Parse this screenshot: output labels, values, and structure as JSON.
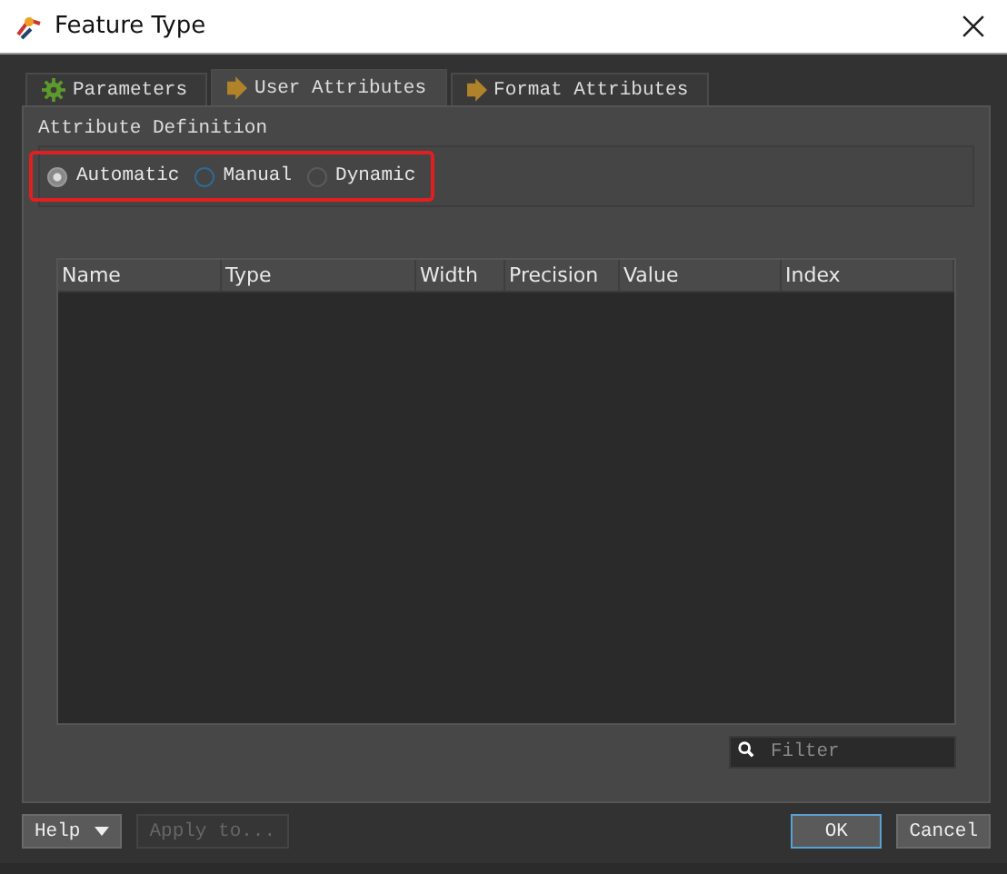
{
  "window": {
    "title": "Feature Type"
  },
  "tabs": [
    {
      "label": "Parameters",
      "selected": false
    },
    {
      "label": "User Attributes",
      "selected": true
    },
    {
      "label": "Format Attributes",
      "selected": false
    }
  ],
  "attribute_definition": {
    "label": "Attribute Definition",
    "options": [
      {
        "label": "Automatic",
        "selected": true,
        "focused": false
      },
      {
        "label": "Manual",
        "selected": false,
        "focused": true
      },
      {
        "label": "Dynamic",
        "selected": false,
        "focused": false
      }
    ]
  },
  "table": {
    "columns": [
      "Name",
      "Type",
      "Width",
      "Precision",
      "Value",
      "Index"
    ]
  },
  "filter": {
    "placeholder": "Filter"
  },
  "buttons": [
    {
      "label": "Help",
      "kind": "dropdown",
      "disabled": false
    },
    {
      "label": "Apply to...",
      "kind": "plain",
      "disabled": true
    },
    {
      "label": "OK",
      "kind": "default",
      "disabled": false
    },
    {
      "label": "Cancel",
      "kind": "plain",
      "disabled": false
    }
  ]
}
